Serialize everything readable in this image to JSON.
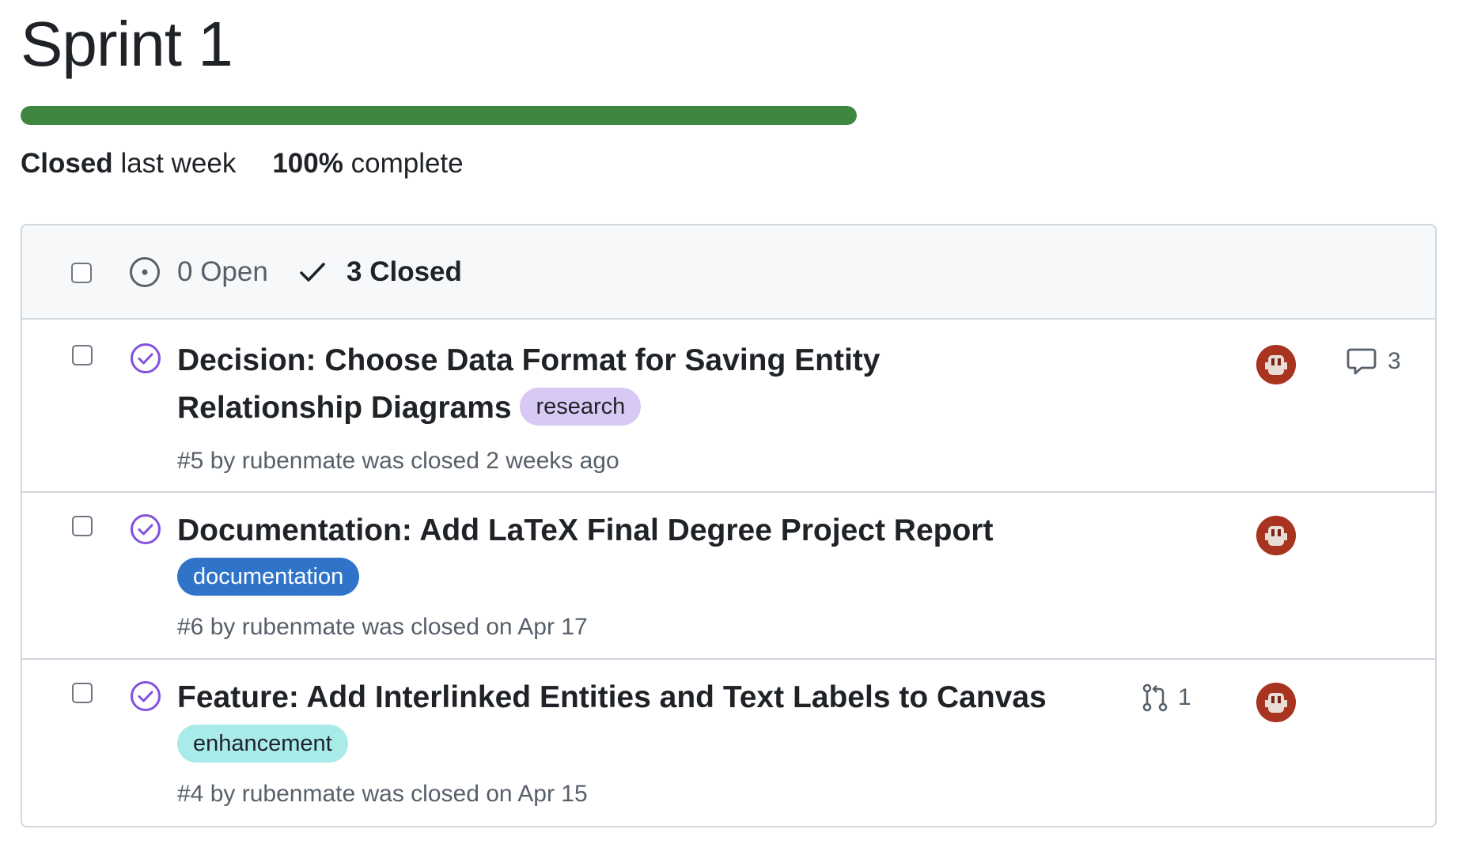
{
  "milestone": {
    "title": "Sprint 1",
    "progress_fraction": 1.0,
    "status_bold": "Closed",
    "status_rest": "last week",
    "percent_bold": "100%",
    "percent_rest": "complete"
  },
  "colors": {
    "progress": "#3f873f",
    "closed_icon": "#8250df",
    "research": "#d8c8f4",
    "documentation": "#2f74c9",
    "enhancement": "#a8ebe9",
    "avatar": "#a8341f"
  },
  "header": {
    "open_label": "0 Open",
    "closed_label": "3 Closed",
    "open_icon": "issue-open-icon",
    "closed_icon": "check-icon"
  },
  "issues": [
    {
      "title": "Decision: Choose Data Format for Saving Entity Relationship Diagrams",
      "label": "research",
      "subtitle": "#5 by rubenmate was closed 2 weeks ago",
      "comments": "3",
      "status_icon": "issue-closed-icon"
    },
    {
      "title": "Documentation: Add LaTeX Final Degree Project Report",
      "label": "documentation",
      "subtitle": "#6 by rubenmate was closed on Apr 17",
      "status_icon": "issue-closed-icon"
    },
    {
      "title": "Feature: Add Interlinked Entities and Text Labels to Canvas",
      "label": "enhancement",
      "subtitle": "#4 by rubenmate was closed on Apr 15",
      "linked_prs": "1",
      "status_icon": "issue-closed-icon"
    }
  ]
}
